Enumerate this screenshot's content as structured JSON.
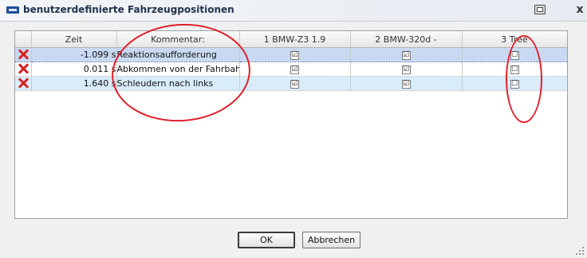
{
  "window": {
    "title": "benutzerdefinierte Fahrzeugpositionen",
    "close_glyph": "x",
    "icons": [
      "vehicle-app-icon",
      "window-option-icon",
      "close-icon"
    ]
  },
  "grid": {
    "columns": [
      "Zeit",
      "Kommentar:",
      "1 BMW-Z3 1.9",
      "2 BMW-320d -",
      "3 Tree"
    ],
    "rows": [
      {
        "zeit": "-1.099 s",
        "kommentar": "Reaktionsaufforderung",
        "bmw_z3": "☑",
        "bmw_320d": "☑",
        "tree": "☐",
        "selected": true
      },
      {
        "zeit": "0.011 s",
        "kommentar": "Abkommen von der Fahrbahn",
        "bmw_z3": "☑",
        "bmw_320d": "☑",
        "tree": "☐",
        "selected": false
      },
      {
        "zeit": "1.640 s",
        "kommentar": "Schleudern nach links",
        "bmw_z3": "☑",
        "bmw_320d": "☑",
        "tree": "☐",
        "selected": false
      }
    ],
    "row_icon": "delete-x-icon"
  },
  "buttons": {
    "ok": "OK",
    "cancel": "Abbrechen"
  },
  "colors": {
    "selected_row": "#c9d9f2",
    "alt_row": "#d8ecfa",
    "annotation_ring": "#e0212b",
    "delete_icon": "#d62222"
  }
}
